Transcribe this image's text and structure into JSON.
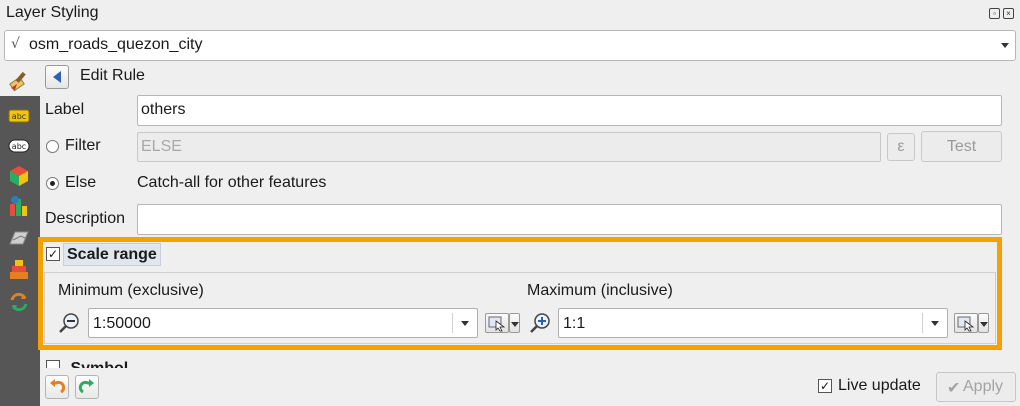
{
  "window": {
    "title": "Layer Styling"
  },
  "layer_selector": {
    "value": "osm_roads_quezon_city"
  },
  "header": {
    "title": "Edit Rule"
  },
  "rule": {
    "label_caption": "Label",
    "label_value": "others",
    "filter_caption": "Filter",
    "filter_value": "ELSE",
    "expression_button": "ε",
    "test_button": "Test",
    "else_caption": "Else",
    "else_description": "Catch-all for other features",
    "description_caption": "Description",
    "description_value": ""
  },
  "scale_range": {
    "title": "Scale range",
    "enabled": true,
    "minimum_label": "Minimum (exclusive)",
    "minimum_value": "1:50000",
    "maximum_label": "Maximum (inclusive)",
    "maximum_value": "1:1"
  },
  "partial_next_section": "Symbol",
  "footer": {
    "live_update_label": "Live update",
    "live_update_checked": true,
    "apply_label": "Apply"
  },
  "colors": {
    "highlight": "#f5a100",
    "sidebar": "#565656",
    "accent_blue": "#2a62b8"
  },
  "icons": [
    "paint-brush-icon",
    "label-abc-icon",
    "label-abc-alt-icon",
    "3d-cube-icon",
    "diagram-icon",
    "mask-icon",
    "stack-icon",
    "history-icon",
    "undo-icon",
    "redo-icon",
    "zoom-out-icon",
    "zoom-in-icon",
    "map-canvas-pick-icon"
  ]
}
